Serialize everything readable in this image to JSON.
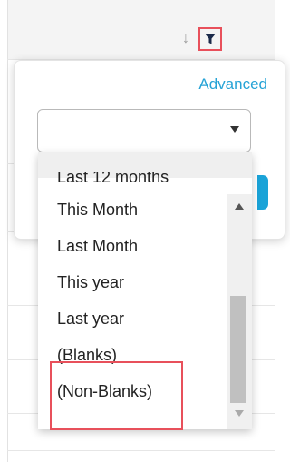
{
  "header": {
    "sort_icon": "arrow-down-icon",
    "filter_icon": "filter-icon"
  },
  "filter_popup": {
    "advanced_label": "Advanced",
    "select_value": ""
  },
  "dropdown": {
    "options": [
      "Last 12 months",
      "This Month",
      "Last Month",
      "This year",
      "Last year",
      "(Blanks)",
      "(Non-Blanks)"
    ]
  },
  "colors": {
    "accent": "#26a3d6",
    "highlight": "#e8505b",
    "apply_button": "#1aa3d8"
  }
}
